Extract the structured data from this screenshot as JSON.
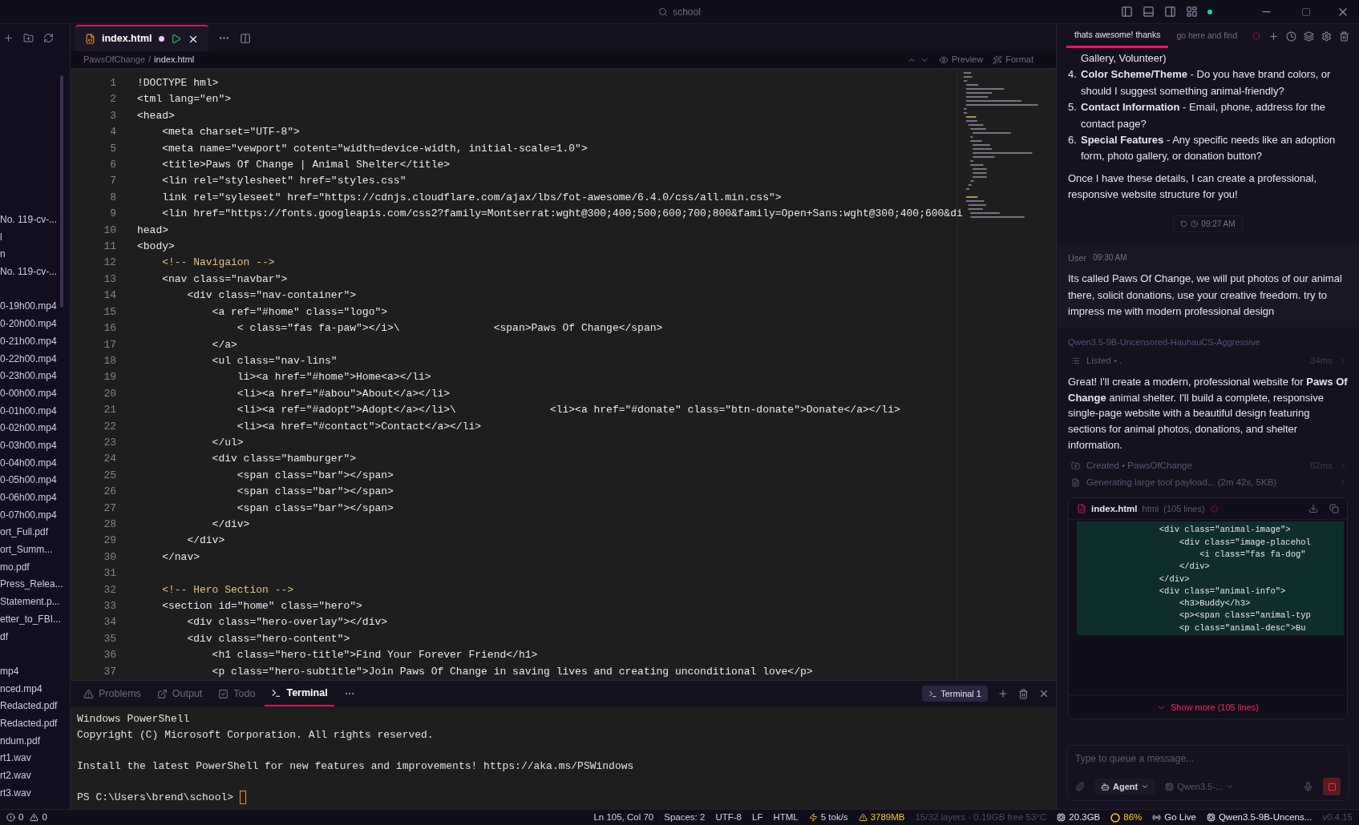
{
  "title_bar": {
    "search": "school"
  },
  "sidebar": {
    "groups": [
      [
        "No. 119-cv-...",
        "l",
        "n",
        "No. 119-cv-..."
      ],
      [
        "0-19h00.mp4",
        "0-20h00.mp4",
        "0-21h00.mp4",
        "0-22h00.mp4",
        "0-23h00.mp4",
        "0-00h00.mp4",
        "0-01h00.mp4",
        "0-02h00.mp4",
        "0-03h00.mp4",
        "0-04h00.mp4",
        "0-05h00.mp4",
        "0-06h00.mp4",
        "0-07h00.mp4",
        "ort_Full.pdf",
        "ort_Summ...",
        "mo.pdf",
        "Press_Relea...",
        "Statement.p...",
        "etter_to_FBI...",
        "df"
      ],
      [
        "mp4",
        "nced.mp4",
        "Redacted.pdf",
        "Redacted.pdf",
        "ndum.pdf",
        "rt1.wav",
        "rt2.wav",
        "rt3.wav"
      ]
    ]
  },
  "editor": {
    "tabs": [
      {
        "label": "index.html",
        "selected": true,
        "modified": true
      }
    ],
    "breadcrumb": {
      "folder": "PawsOfChange",
      "separator": "/",
      "file": "index.html"
    },
    "toolbar": [
      "Preview",
      "Format"
    ],
    "lines": [
      {
        "n": "1",
        "kind": "code",
        "code": "!DOCTYPE hml>"
      },
      {
        "n": "2",
        "kind": "code",
        "code": "<tml lang=\"en\">"
      },
      {
        "n": "3",
        "kind": "code",
        "code": "<head>"
      },
      {
        "n": "4",
        "kind": "code",
        "code": "    <meta charset=\"UTF-8\">"
      },
      {
        "n": "5",
        "kind": "code",
        "code": "    <meta name=\"vewport\" cotent=\"width=device-width, initial-scale=1.0\">"
      },
      {
        "n": "6",
        "kind": "code",
        "code": "    <title>Paws Of Change | Animal Shelter</title>"
      },
      {
        "n": "7",
        "kind": "code",
        "code": "    <lin rel=\"stylesheet\" href=\"styles.css\""
      },
      {
        "n": "8",
        "kind": "code",
        "code": "    link rel=\"syleseet\" href=\"https://cdnjs.cloudflare.com/ajax/lbs/fot-awesome/6.4.0/css/all.min.css\">"
      },
      {
        "n": "9",
        "kind": "code",
        "code": "    <lin href=\"https://fonts.googleapis.com/css2?family=Montserrat:wght@300;400;500;600;700;800&family=Open+Sans:wght@300;400;600&di"
      },
      {
        "n": "10",
        "kind": "code",
        "code": "head>"
      },
      {
        "n": "11",
        "kind": "code",
        "code": "<body>"
      },
      {
        "n": "12",
        "kind": "comment",
        "code": "    <!-- Navigaion -->"
      },
      {
        "n": "13",
        "kind": "code",
        "code": "    <nav class=\"navbar\">"
      },
      {
        "n": "14",
        "kind": "code",
        "code": "        <div class=\"nav-container\">"
      },
      {
        "n": "15",
        "kind": "code",
        "code": "            <a ref=\"#home\" class=\"logo\">"
      },
      {
        "n": "16",
        "kind": "code",
        "code": "                < class=\"fas fa-paw\"></i>\\               <span>Paws Of Change</span>"
      },
      {
        "n": "17",
        "kind": "code",
        "code": "            </a>"
      },
      {
        "n": "18",
        "kind": "code",
        "code": "            <ul class=\"nav-lins\""
      },
      {
        "n": "19",
        "kind": "code",
        "code": "                li><a href=\"#home\">Home<a></li>"
      },
      {
        "n": "20",
        "kind": "code",
        "code": "                <li><a href=\"#abou\">About</a></li>"
      },
      {
        "n": "21",
        "kind": "code",
        "code": "                <li><a ref=\"#adopt\">Adopt</a></li>\\               <li><a href=\"#donate\" class=\"btn-donate\">Donate</a></li>"
      },
      {
        "n": "22",
        "kind": "code",
        "code": "                <li><a href=\"#contact\">Contact</a></li>"
      },
      {
        "n": "23",
        "kind": "code",
        "code": "            </ul>"
      },
      {
        "n": "24",
        "kind": "code",
        "code": "            <div class=\"hamburger\">"
      },
      {
        "n": "25",
        "kind": "code",
        "code": "                <span class=\"bar\"></span>"
      },
      {
        "n": "26",
        "kind": "code",
        "code": "                <span class=\"bar\"></span>"
      },
      {
        "n": "27",
        "kind": "code",
        "code": "                <span class=\"bar\"></span>"
      },
      {
        "n": "28",
        "kind": "code",
        "code": "            </div>"
      },
      {
        "n": "29",
        "kind": "code",
        "code": "        </div>"
      },
      {
        "n": "30",
        "kind": "code",
        "code": "    </nav>"
      },
      {
        "n": "31",
        "kind": "code"
      },
      {
        "n": "32",
        "kind": "comment",
        "code": "    <!-- Hero Section -->"
      },
      {
        "n": "33",
        "kind": "code",
        "code": "    <section id=\"home\" class=\"hero\">"
      },
      {
        "n": "34",
        "kind": "code",
        "code": "        <div class=\"hero-overlay\"></div>"
      },
      {
        "n": "35",
        "kind": "code",
        "code": "        <div class=\"hero-content\">"
      },
      {
        "n": "36",
        "kind": "code",
        "code": "            <h1 class=\"hero-title\">Find Your Forever Friend</h1>"
      },
      {
        "n": "37",
        "kind": "code",
        "code": "            <p class=\"hero-subtitle\">Join Paws Of Change in saving lives and creating unconditional love</p>"
      }
    ]
  },
  "panel": {
    "tabs": [
      {
        "label": "Problems",
        "selected": false
      },
      {
        "label": "Output",
        "selected": false
      },
      {
        "label": "Todo",
        "selected": false
      },
      {
        "label": "Terminal",
        "selected": true
      }
    ],
    "terminal_name": "Terminal 1",
    "output": [
      {
        "kind": "text",
        "text": "Windows PowerShell"
      },
      {
        "kind": "text",
        "text": "Copyright (C) Microsoft Corporation. All rights reserved."
      },
      {
        "kind": "blank"
      },
      {
        "kind": "text",
        "text": "Install the latest PowerShell for new features and improvements! https://aka.ms/PSWindows"
      },
      {
        "kind": "blank"
      }
    ],
    "prompt": "PS C:\\Users\\brend\\school>"
  },
  "status_bar": {
    "errors": "0",
    "warnings": "0",
    "items": [
      {
        "kind": "plain",
        "label": "Ln 105, Col 70"
      },
      {
        "kind": "plain",
        "label": "Spaces: 2"
      },
      {
        "kind": "plain",
        "label": "UTF-8"
      },
      {
        "kind": "plain",
        "label": "LF"
      },
      {
        "kind": "plain",
        "label": "HTML"
      },
      {
        "kind": "speed",
        "label": "5 tok/s"
      },
      {
        "kind": "memory",
        "label": "3789MB"
      },
      {
        "kind": "dim",
        "label": "15/32 layers · 0.19GB free 53°C"
      },
      {
        "kind": "chip",
        "label": "20.3GB"
      },
      {
        "kind": "ring",
        "label": "86%"
      },
      {
        "kind": "live",
        "label": "Go Live"
      },
      {
        "kind": "chip",
        "label": "Qwen3.5-9B-Uncens..."
      },
      {
        "kind": "dim",
        "label": "v0.4.15"
      }
    ]
  },
  "chat": {
    "tabs": [
      {
        "label": "thats awesome! thanks",
        "selected": true
      },
      {
        "label": "go here and find",
        "selected": false
      }
    ],
    "messages": [
      {
        "kind": "assistant_list",
        "continuation": "Gallery, Volunteer)",
        "items": [
          {
            "number": "4.",
            "text": "**Color Scheme/Theme** - Do you have brand colors, or should I suggest something animal-friendly?"
          },
          {
            "number": "5.",
            "text": "**Contact Information** - Email, phone, address for the contact page?"
          },
          {
            "number": "6.",
            "text": "**Special Features** - Any specific needs like an adoption form, photo gallery, or donation button?"
          }
        ],
        "paragraph": "Once I have these details, I can create a professional, responsive website structure for you!"
      },
      {
        "kind": "timestamp",
        "time": "09:27 AM"
      },
      {
        "kind": "user",
        "author": "User",
        "time": "09:30 AM",
        "text": "Its called Paws Of Change, we will put photos of our animal there, solicit donations, use your creative freedom. try to impress me with modern professional design"
      },
      {
        "kind": "assistant",
        "author": "Qwen3.5-9B-Uncensored-HauhauCS-Aggressive",
        "blocks": [
          {
            "kind": "listed",
            "label": "Listed • .",
            "duration": "34ms"
          },
          {
            "kind": "text",
            "text": "Great! I'll create a modern, professional website for **Paws Of Change** animal shelter. I'll build a complete, responsive single-page website with a beautiful design featuring sections for animal photos, donations, and shelter information."
          },
          {
            "kind": "created",
            "label": "Created • PawsOfChange",
            "duration": "62ms"
          },
          {
            "kind": "generating",
            "label": "Generating large tool payload... (2m 42s, 5KB)"
          },
          {
            "kind": "code",
            "file": "index.html",
            "lang": "html",
            "count": "(105 lines)",
            "more": "Show more (105 lines)",
            "lines": [
              "                <div class=\"animal-image\">",
              "                    <div class=\"image-placehol",
              "                        <i class=\"fas fa-dog\"",
              "                    </div>",
              "                </div>",
              "                <div class=\"animal-info\">",
              "                    <h3>Buddy</h3>",
              "                    <p><span class=\"animal-typ",
              "                    <p class=\"animal-desc\">Bu"
            ]
          }
        ]
      }
    ],
    "input": {
      "placeholder": "Type to queue a message...",
      "mode": "Agent",
      "model": "Qwen3.5-..."
    }
  }
}
